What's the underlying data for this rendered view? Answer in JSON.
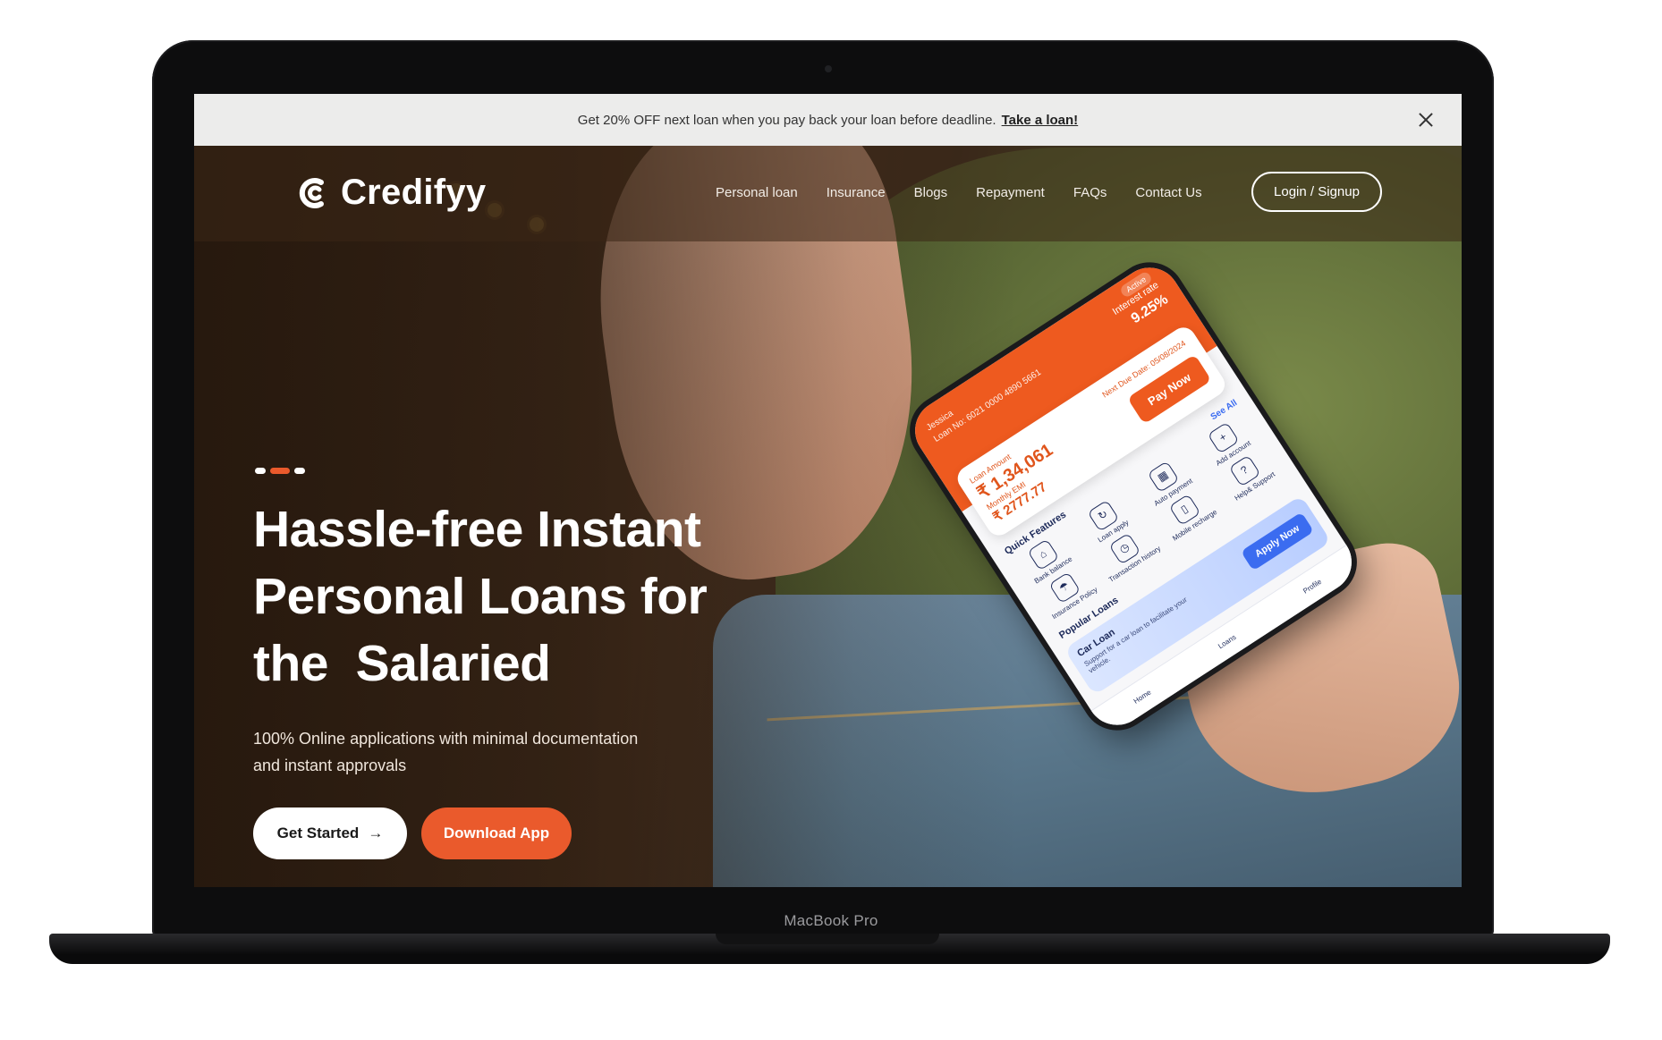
{
  "device": {
    "label": "MacBook Pro"
  },
  "promo": {
    "text": "Get 20% OFF next loan when you pay back your loan before deadline.",
    "link": "Take a loan!"
  },
  "header": {
    "logo": "Credifyy",
    "nav": [
      "Personal loan",
      "Insurance",
      "Blogs",
      "Repayment",
      "FAQs",
      "Contact Us"
    ],
    "login": "Login / Signup"
  },
  "hero": {
    "title_lines": [
      "Hassle-free Instant",
      "Personal Loans for",
      "the  Salaried"
    ],
    "subtitle_lines": [
      "100% Online applications with minimal documentation",
      "and instant approvals"
    ],
    "primary_button": "Get Started",
    "secondary_button": "Download App"
  },
  "phone": {
    "status": "Active",
    "name": "Jessica",
    "loan_number": "Loan No: 6021 0000 4890 5661",
    "interest_label": "Interest rate",
    "interest_value": "9.25%",
    "loan_amount_label": "Loan Amount",
    "loan_amount": "₹ 1,34,061",
    "emi_label": "Monthly EMI",
    "emi": "₹ 2777.77",
    "due_label": "Next Due Date: 05/08/2024",
    "pay_button": "Pay Now",
    "features_title": "Quick Features",
    "see_all": "See All",
    "features": [
      "Bank balance",
      "Loan apply",
      "Auto payment",
      "Add account",
      "Insurance Policy",
      "Transaction history",
      "Mobile recharge",
      "Help& Support"
    ],
    "popular_title": "Popular Loans",
    "loan_card_title": "Car Loan",
    "loan_card_desc": "Support for a car loan to facilitate your vehicle.",
    "apply_button": "Apply Now",
    "nav": [
      "Home",
      "Loans",
      "Profile"
    ]
  },
  "colors": {
    "accent": "#ea5a2c",
    "promo_bg": "#ececeb"
  }
}
